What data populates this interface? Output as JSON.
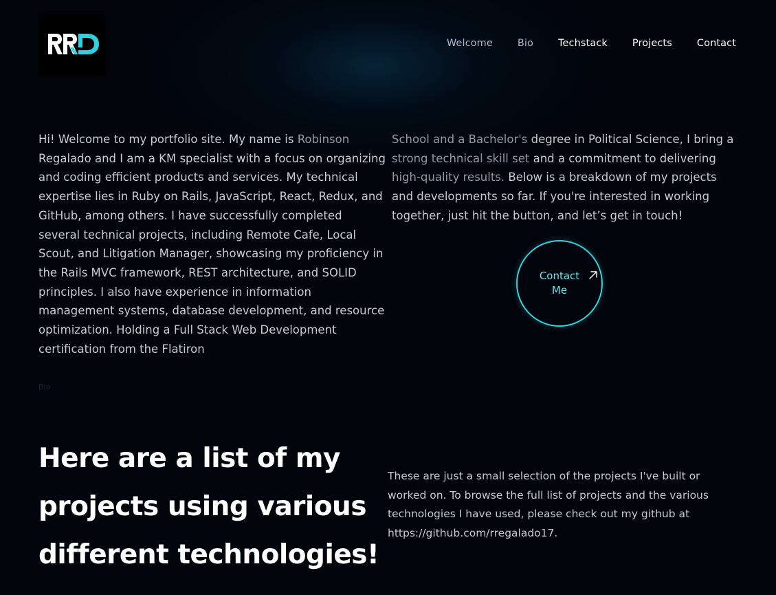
{
  "logo": {
    "text": "RRD",
    "primary_color": "#ffffff",
    "accent_color": "#2fd3df"
  },
  "nav": {
    "items": [
      "Welcome",
      "Bio",
      "Techstack",
      "Projects",
      "Contact"
    ]
  },
  "intro": {
    "left_part1": "Hi! Welcome to my portfolio site. My name is ",
    "left_part2": "Robinson",
    "left_part3": " Regalado and I am a KM specialist with a focus on organizing and coding efficient products and services. My technical expertise lies in Ruby on Rails, JavaScript, React, Redux, and GitHub, among others. I have successfully completed several technical projects, including Remote Cafe, Local Scout, and Litigation Manager, showcasing my proficiency in the Rails MVC framework, REST architecture, and SOLID principles. I also have experience in information management systems, database development, and resource optimization. Holding a Full Stack Web Development certification from the Flatiron",
    "right_part1": "School and a Bachelor's",
    "right_part2": " degree in Political Science, I bring a ",
    "right_part3": "strong technical skill set",
    "right_part4": " and a commitment to delivering ",
    "right_part5": "high-quality results.",
    "right_part6": " Below is a breakdown of my projects and developments so far. If you're interested in working together, just hit the button, and let’s get in touch!"
  },
  "contact_button": {
    "label": "Contact Me",
    "accent_color": "#2fd3df"
  },
  "section_label": "Bio",
  "projects": {
    "heading": "Here are a list of my projects using various different technologies!",
    "description": "These are just a small selection of the projects I've built or worked on. To browse the full list of projects and the various technologies I have used, please check out my github at https://github.com/rregalado17."
  }
}
